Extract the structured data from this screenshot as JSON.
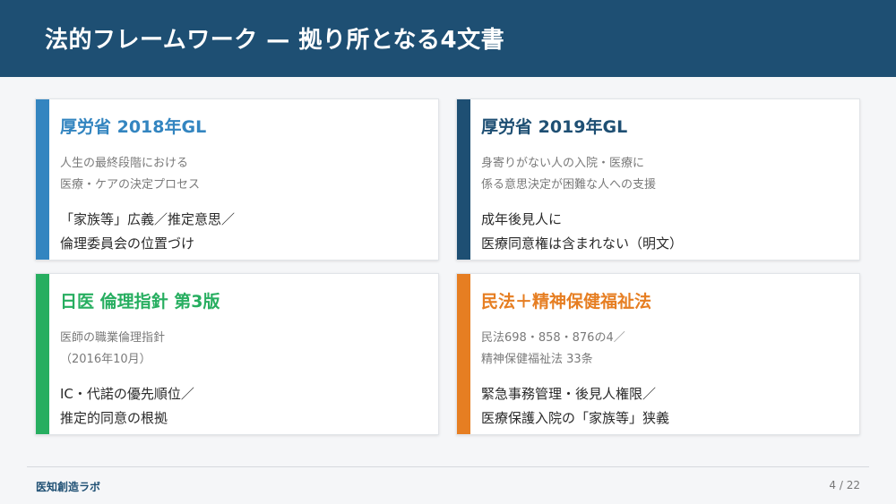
{
  "header": {
    "title": "法的フレームワーク — 拠り所となる4文書"
  },
  "colors": {
    "header_bg": "#1e4f73",
    "blue": "#3385c0",
    "navy": "#1e4f73",
    "green": "#27ae60",
    "orange": "#e67e22"
  },
  "cards": [
    {
      "title": "厚労省 2018年GL",
      "accent": "#3385c0",
      "sub": [
        "人生の最終段階における",
        "医療・ケアの決定プロセス"
      ],
      "main": [
        "「家族等」広義／推定意思／",
        "倫理委員会の位置づけ"
      ]
    },
    {
      "title": "厚労省 2019年GL",
      "accent": "#1e4f73",
      "sub": [
        "身寄りがない人の入院・医療に",
        "係る意思決定が困難な人への支援"
      ],
      "main": [
        "成年後見人に",
        "医療同意権は含まれない（明文）"
      ]
    },
    {
      "title": "日医 倫理指針 第3版",
      "accent": "#27ae60",
      "sub": [
        "医師の職業倫理指針",
        "（2016年10月）"
      ],
      "main": [
        "IC・代諾の優先順位／",
        "推定的同意の根拠"
      ]
    },
    {
      "title": "民法＋精神保健福祉法",
      "accent": "#e67e22",
      "sub": [
        "民法698・858・876の4／",
        "精神保健福祉法 33条"
      ],
      "main": [
        "緊急事務管理・後見人権限／",
        "医療保護入院の「家族等」狭義"
      ]
    }
  ],
  "footer": {
    "brand": "医知創造ラボ",
    "page": "4 / 22"
  }
}
